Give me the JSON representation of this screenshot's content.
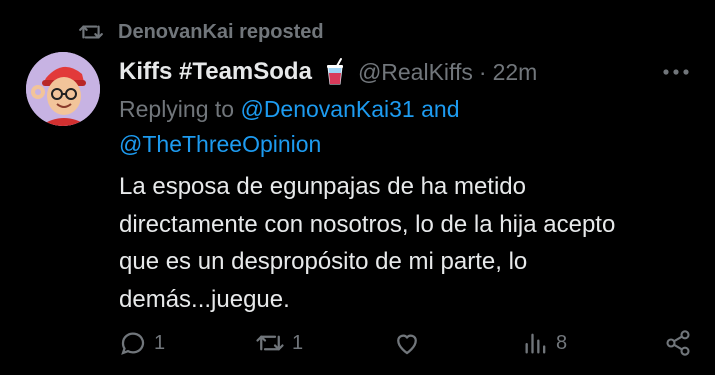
{
  "repost": {
    "text": "DenovanKai reposted",
    "icon": "repost-icon"
  },
  "author": {
    "display_name": "Kiffs #TeamSoda",
    "badge_icon": "soda-cup-emoji-icon",
    "handle": "@RealKiffs",
    "separator": "·",
    "time": "22m",
    "avatar": "cartoon-avatar"
  },
  "reply": {
    "prefix": "Replying to ",
    "mention1": "@DenovanKai31",
    "conjunction": " and",
    "mention2": "@TheThreeOpinion"
  },
  "tweet": {
    "lines": [
      "La esposa de egunpajas de ha metido",
      "directamente con nosotros, lo de la hija acepto",
      "que es un despropósito de mi parte, lo",
      "demás...juegue."
    ]
  },
  "actions": {
    "reply_count": "1",
    "repost_count": "1",
    "like_count": "",
    "views_count": "8"
  },
  "colors": {
    "background": "#000000",
    "text": "#e7e9ea",
    "secondary": "#71767b",
    "link": "#1d9bf0"
  }
}
